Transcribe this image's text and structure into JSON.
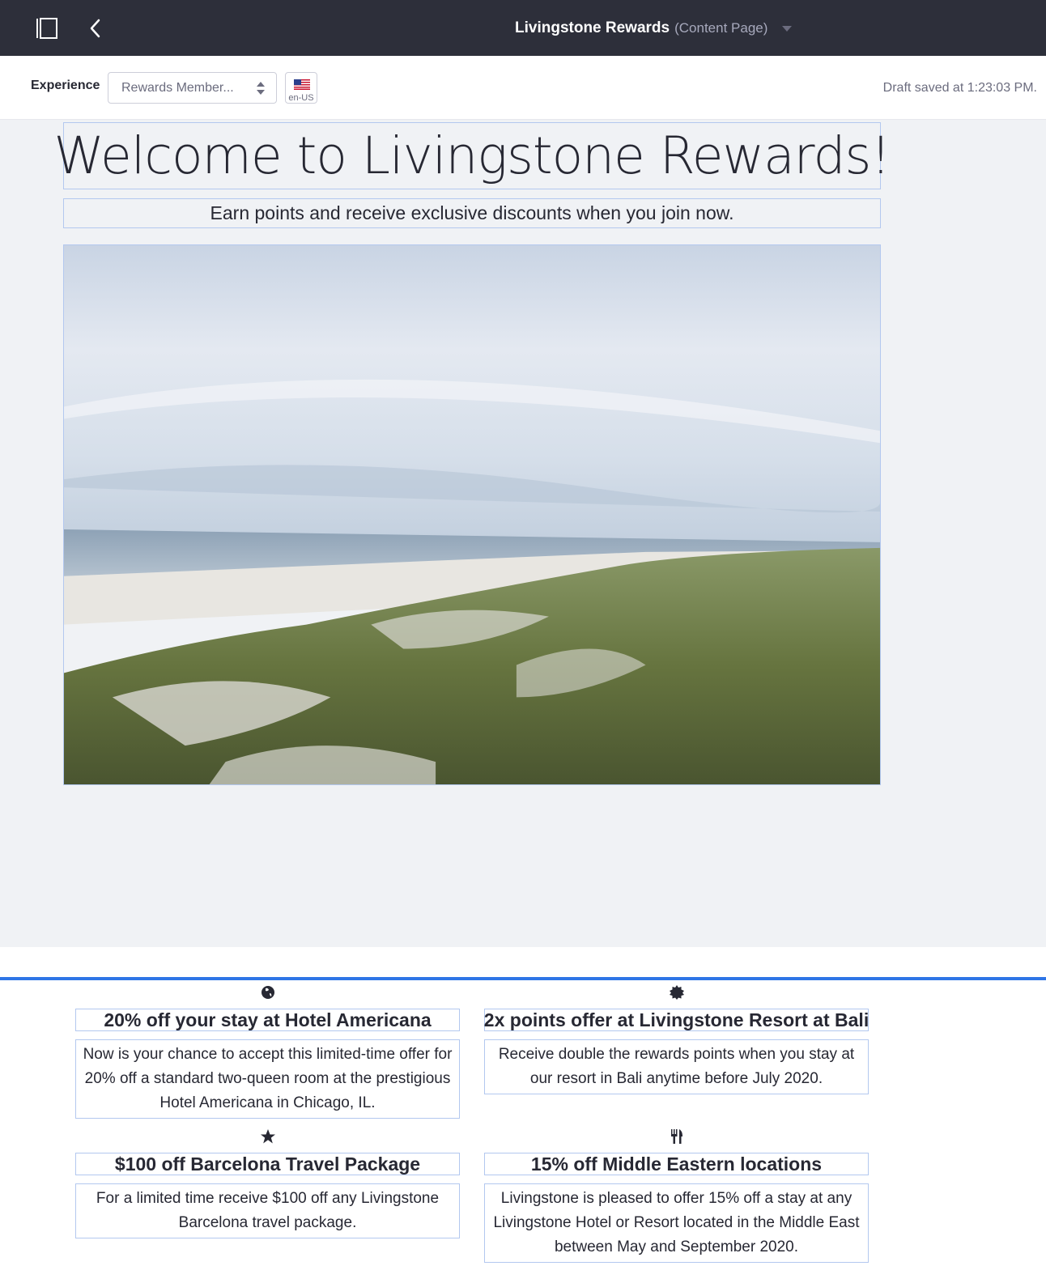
{
  "topbar": {
    "title": "Livingstone Rewards",
    "subtitle": "(Content Page)",
    "icons": [
      "sidebar-toggle-icon",
      "back-chevron-icon",
      "caret-down-icon"
    ]
  },
  "toolbar": {
    "experience_label": "Experience",
    "experience_value": "Rewards Member...",
    "language_code": "en-US",
    "draft_status": "Draft saved at 1:23:03 PM."
  },
  "hero": {
    "heading": "Welcome to Livingstone Rewards!",
    "subheading": "Earn points and receive exclusive discounts when you join now."
  },
  "cards": [
    {
      "icon": "globe-icon",
      "title": "20% off your stay at Hotel Americana",
      "body": "Now is your chance to accept this limited-time offer for 20% off a standard two-queen room at the prestigious Hotel Americana in Chicago, IL."
    },
    {
      "icon": "badge-icon",
      "title": "2x points offer at Livingstone Resort at Bali",
      "body": "Receive double the rewards points when you stay at our resort in Bali anytime before July 2020."
    },
    {
      "icon": "star-icon",
      "title": "$100 off Barcelona Travel Package",
      "body": "For a limited time receive $100 off any Livingstone Barcelona travel package."
    },
    {
      "icon": "cutlery-icon",
      "title": "15% off Middle Eastern locations",
      "body": "Livingstone is pleased to offer 15% off a stay at any Livingstone Hotel or Resort located in the Middle East between May and September 2020."
    }
  ],
  "colors": {
    "topbar_bg": "#2d2f3a",
    "canvas_bg": "#f0f2f5",
    "fragment_border": "#b3c8ef",
    "drop_indicator": "#2e75e6"
  }
}
